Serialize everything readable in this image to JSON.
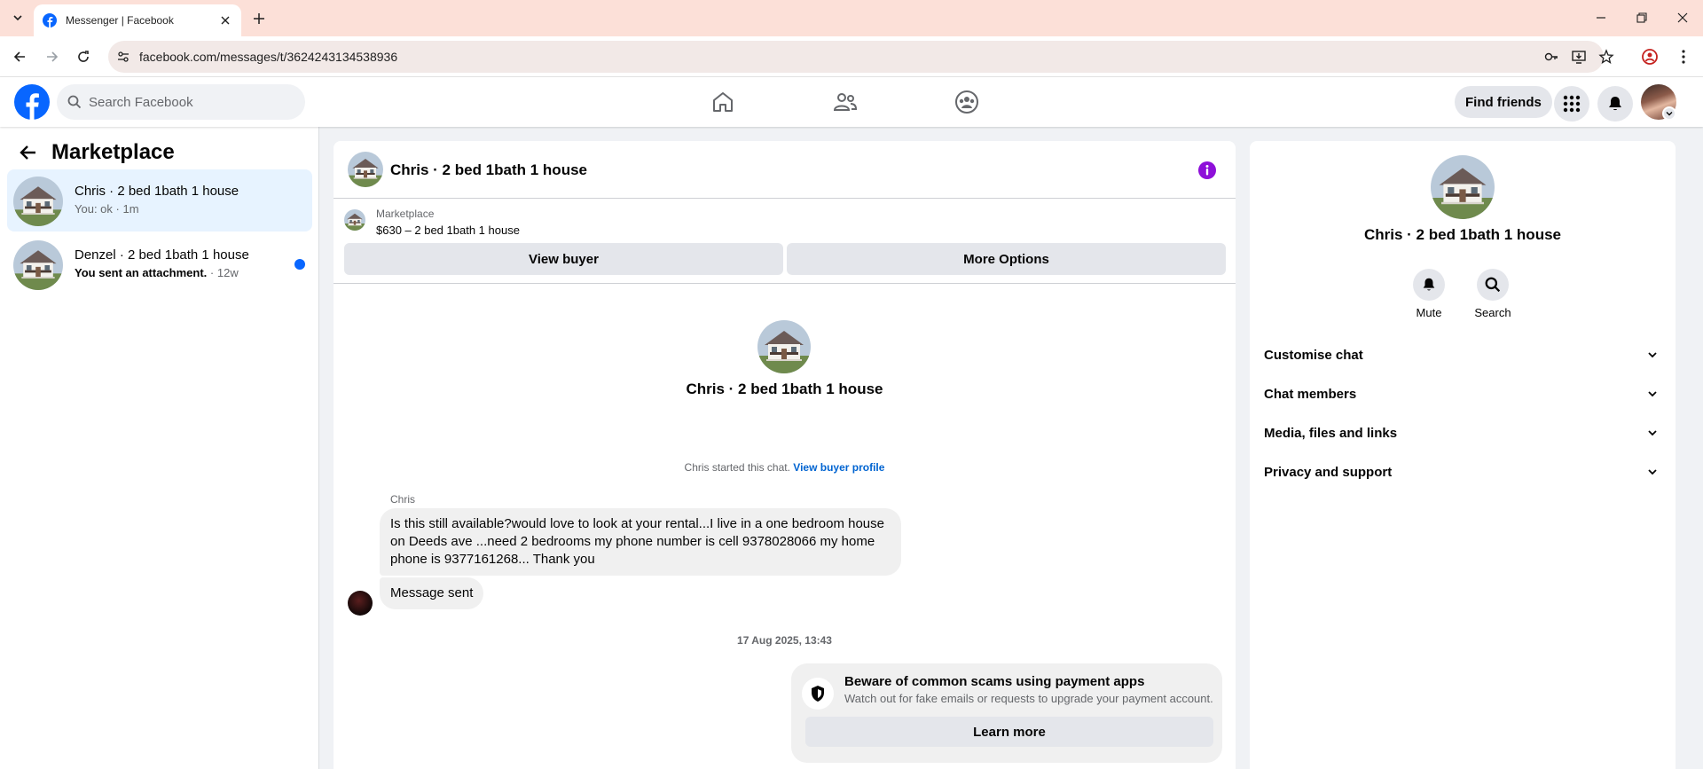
{
  "browser": {
    "tab_title": "Messenger | Facebook",
    "url": "facebook.com/messages/t/3624243134538936"
  },
  "header": {
    "search_placeholder": "Search Facebook",
    "find_friends": "Find friends",
    "brand_color": "#0866ff"
  },
  "sidebar": {
    "title": "Marketplace",
    "conversations": [
      {
        "name": "Chris · 2 bed 1bath 1 house",
        "preview": "You: ok",
        "time": "· 1m",
        "active": true,
        "unread": false
      },
      {
        "name": "Denzel · 2 bed 1bath 1 house",
        "preview": "You sent an attachment.",
        "time": "· 12w",
        "active": false,
        "unread": true
      }
    ]
  },
  "chat": {
    "title": "Chris · 2 bed 1bath 1 house",
    "listing_label": "Marketplace",
    "listing_price": "$630 – 2 bed 1bath 1 house",
    "view_buyer": "View buyer",
    "more_options": "More Options",
    "hero_title": "Chris · 2 bed 1bath 1 house",
    "started_text": "Chris started this chat.",
    "view_buyer_profile": "View buyer profile",
    "sender": "Chris",
    "message_1": "Is this still available?would love to look at your rental...I live in a one bedroom house on Deeds ave ...need 2 bedrooms my phone number is cell 9378028066 my home phone is 9377161268... Thank you",
    "message_2": "Message sent",
    "timestamp": "17 Aug 2025, 13:43",
    "scam_title": "Beware of common scams using payment apps",
    "scam_sub": "Watch out for fake emails or requests to upgrade your payment account.",
    "learn_more": "Learn more"
  },
  "info_panel": {
    "title": "Chris · 2 bed 1bath 1 house",
    "mute": "Mute",
    "search": "Search",
    "sections": [
      "Customise chat",
      "Chat members",
      "Media, files and links",
      "Privacy and support"
    ]
  }
}
